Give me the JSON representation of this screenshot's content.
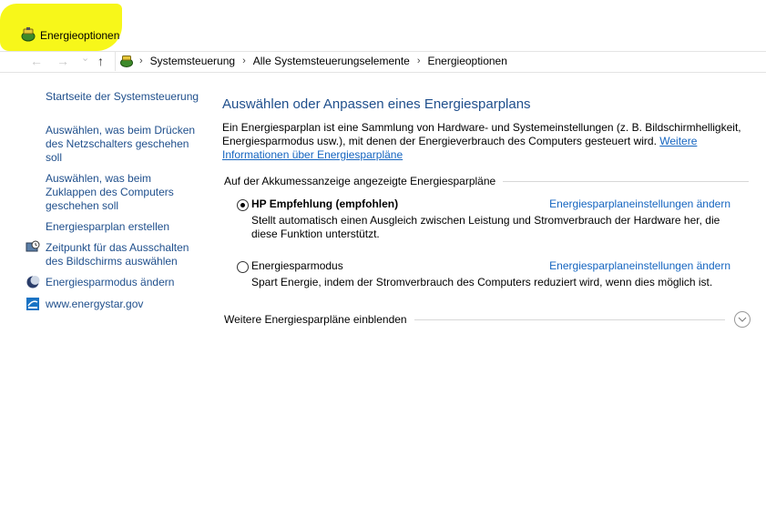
{
  "window": {
    "title": "Energieoptionen",
    "highlight_color": "#f7f71a"
  },
  "nav": {
    "back": "←",
    "forward": "→",
    "recent": "⌄",
    "up": "↑"
  },
  "breadcrumb": {
    "items": [
      "Systemsteuerung",
      "Alle Systemsteuerungselemente",
      "Energieoptionen"
    ],
    "separator": "›"
  },
  "sidebar": {
    "home": "Startseite der Systemsteuerung",
    "items": [
      {
        "label": "Auswählen, was beim Drücken des Netzschalters geschehen soll",
        "icon": ""
      },
      {
        "label": "Auswählen, was beim Zuklappen des Computers geschehen soll",
        "icon": ""
      },
      {
        "label": "Energiesparplan erstellen",
        "icon": ""
      },
      {
        "label": "Zeitpunkt für das Ausschalten des Bildschirms auswählen",
        "icon": "monitor-clock-icon"
      },
      {
        "label": "Energiesparmodus ändern",
        "icon": "moon-icon"
      },
      {
        "label": "www.energystar.gov",
        "icon": "energystar-icon"
      }
    ]
  },
  "main": {
    "heading": "Auswählen oder Anpassen eines Energiesparplans",
    "description": "Ein Energiesparplan ist eine Sammlung von Hardware- und Systemeinstellungen (z. B. Bildschirmhelligkeit, Energiesparmodus usw.), mit denen der Energieverbrauch des Computers gesteuert wird.",
    "more_info_link": "Weitere Informationen über Energiesparpläne",
    "group_label": "Auf der Akkumessanzeige angezeigte Energiesparpläne",
    "plans": [
      {
        "name": "HP Empfehlung (empfohlen)",
        "selected": true,
        "link": "Energiesparplaneinstellungen ändern",
        "description": "Stellt automatisch einen Ausgleich zwischen Leistung und Stromverbrauch der Hardware her, die diese Funktion unterstützt."
      },
      {
        "name": "Energiesparmodus",
        "selected": false,
        "link": "Energiesparplaneinstellungen ändern",
        "description": "Spart Energie, indem der Stromverbrauch des Computers reduziert wird, wenn dies möglich ist."
      }
    ],
    "show_more": "Weitere Energiesparpläne einblenden"
  },
  "colors": {
    "link": "#1565c0",
    "heading": "#1f4f8c"
  }
}
